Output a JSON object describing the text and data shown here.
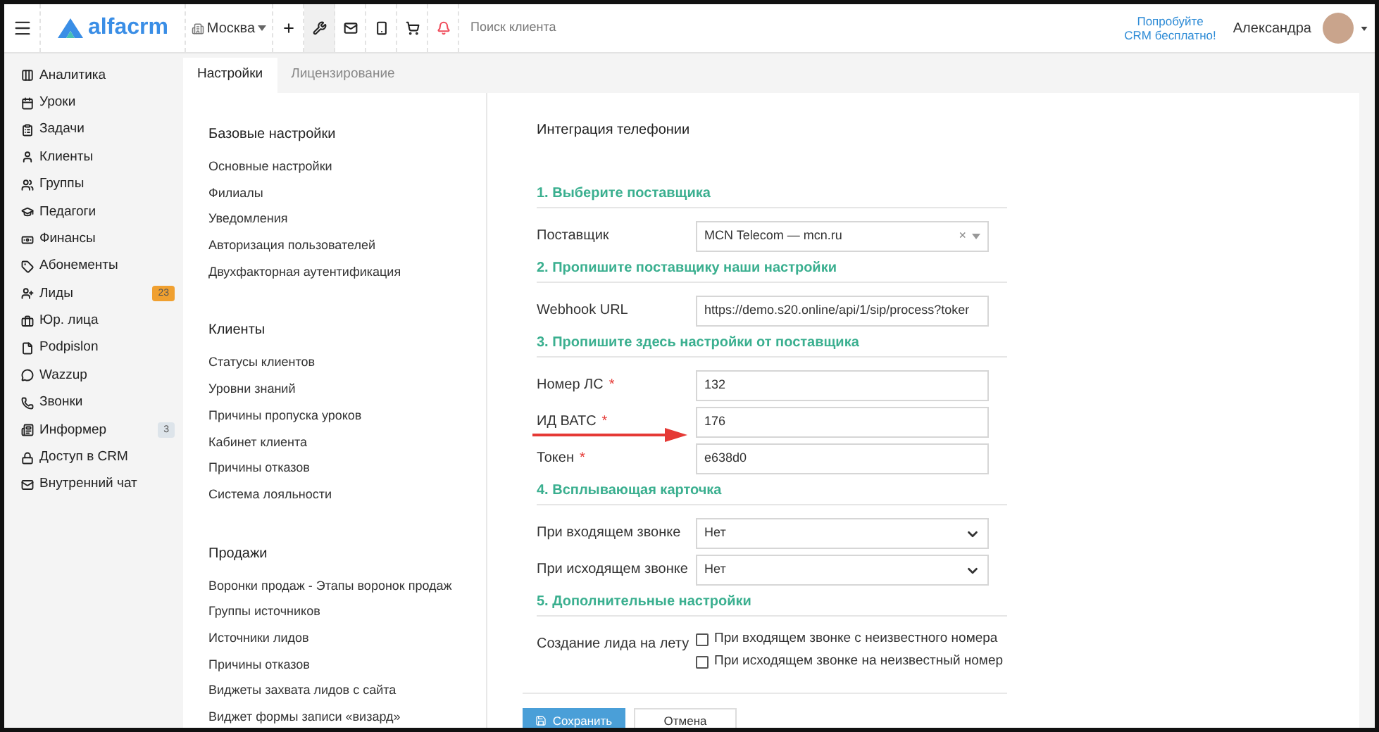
{
  "topbar": {
    "logo": "alfacrm",
    "branch": "Москва",
    "search": {
      "placeholder": "Поиск клиента"
    },
    "tools": [
      {
        "kind": "plus",
        "selected": false
      },
      {
        "kind": "wrench",
        "selected": true
      },
      {
        "kind": "mail",
        "selected": false
      },
      {
        "kind": "phone",
        "selected": false
      },
      {
        "kind": "cart",
        "selected": false
      },
      {
        "kind": "bell",
        "selected": false
      }
    ],
    "promo": [
      "Попробуйте",
      "CRM бесплатно!"
    ],
    "user": "Александра"
  },
  "sidebar": {
    "items": [
      {
        "label": "Аналитика"
      },
      {
        "label": "Уроки"
      },
      {
        "label": "Задачи"
      },
      {
        "label": "Клиенты"
      },
      {
        "label": "Группы"
      },
      {
        "label": "Педагоги"
      },
      {
        "label": "Финансы"
      },
      {
        "label": "Абонементы"
      },
      {
        "label": "Лиды",
        "badge": "23",
        "color": "#f0a030"
      },
      {
        "label": "Юр. лица"
      },
      {
        "label": "Podpislon"
      },
      {
        "label": "Wazzup"
      },
      {
        "label": "Звонки"
      },
      {
        "label": "Информер",
        "badge": "3",
        "color": "#dde4ea"
      },
      {
        "label": "Доступ в CRM"
      },
      {
        "label": "Внутренний чат"
      }
    ]
  },
  "tabs": [
    {
      "label": "Настройки",
      "selected": true
    },
    {
      "label": "Лицензирование",
      "selected": false
    }
  ],
  "settings_nav": [
    {
      "title": "Базовые настройки",
      "items": [
        "Основные настройки",
        "Филиалы",
        "Уведомления",
        "Авторизация пользователей",
        "Двухфакторная аутентификация"
      ]
    },
    {
      "title": "Клиенты",
      "items": [
        "Статусы клиентов",
        "Уровни знаний",
        "Причины пропуска уроков",
        "Кабинет клиента",
        "Причины отказов",
        "Система лояльности"
      ]
    },
    {
      "title": "Продажи",
      "items": [
        "Воронки продаж - Этапы воронок продаж",
        "Группы источников",
        "Источники лидов",
        "Причины отказов",
        "Виджеты захвата лидов с сайта",
        "Виджет формы записи «визард»"
      ]
    }
  ],
  "form": {
    "title": "Интеграция телефонии",
    "sections": [
      {
        "title": "1. Выберите поставщика",
        "fields": [
          {
            "kind": "combo",
            "label": "Поставщик",
            "value": "MCN Telecom — mcn.ru",
            "clear": "×"
          }
        ]
      },
      {
        "title": "2. Пропишите поставщику наши настройки",
        "fields": [
          {
            "kind": "input",
            "label": "Webhook URL",
            "value": "https://demo.s20.online/api/1/sip/process?toker"
          }
        ]
      },
      {
        "title": "3. Пропишите здесь настройки от поставщика",
        "fields": [
          {
            "kind": "input",
            "label": "Номер ЛС",
            "required": "*",
            "value": "132"
          },
          {
            "kind": "input",
            "label": "ИД ВАТС",
            "required": "*",
            "value": "176",
            "arrow": true
          },
          {
            "kind": "input",
            "label": "Токен",
            "required": "*",
            "value": "e638d0"
          }
        ]
      },
      {
        "title": "4. Всплывающая карточка",
        "fields": [
          {
            "kind": "select",
            "label": "При входящем звонке",
            "value": "Нет"
          },
          {
            "kind": "select",
            "label": "При исходящем звонке",
            "value": "Нет"
          }
        ]
      },
      {
        "title": "5. Дополнительные настройки",
        "fields": [
          {
            "kind": "checks",
            "label": "Создание лида на лету",
            "options": [
              {
                "label": "При входящем звонке с неизвестного номера",
                "checked": false
              },
              {
                "label": "При исходящем звонке на неизвестный номер",
                "checked": false
              }
            ]
          }
        ]
      }
    ],
    "buttons": [
      {
        "kind": "primary",
        "label": "Сохранить"
      },
      {
        "kind": "secondary",
        "label": "Отмена"
      }
    ]
  }
}
